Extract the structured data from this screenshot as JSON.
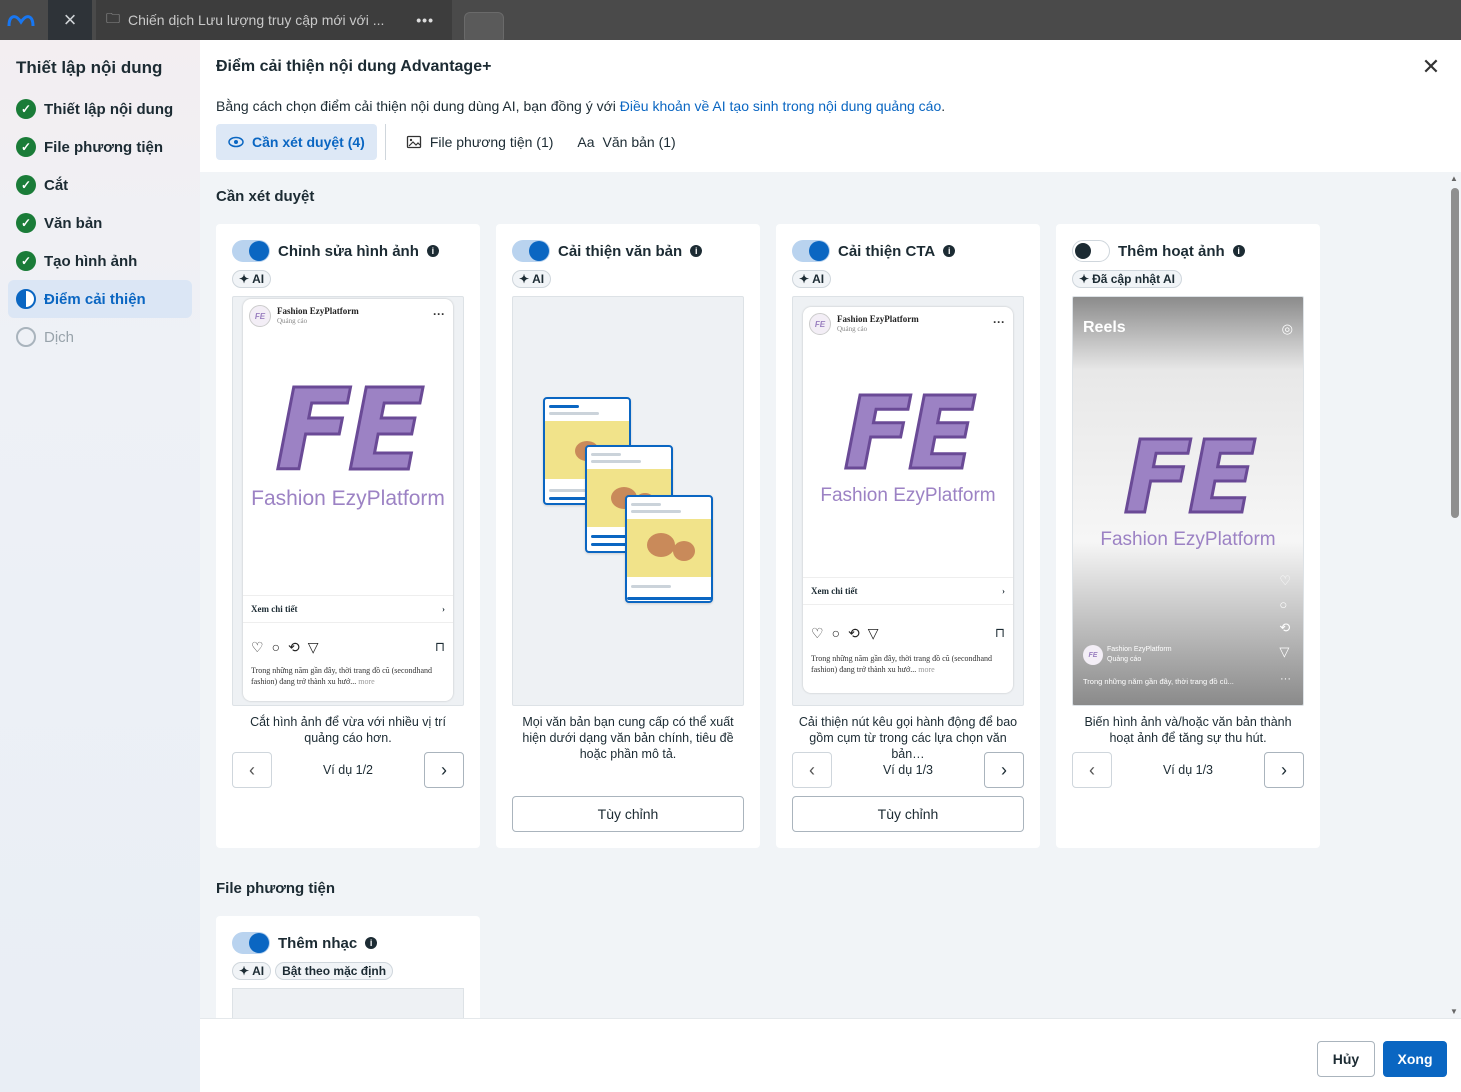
{
  "topbar": {
    "close_icon": "close-icon",
    "campaign_title": "Chiến dịch Lưu lượng truy cập mới với ...",
    "more": "•••"
  },
  "sidebar": {
    "title": "Thiết lập nội dung",
    "steps": [
      {
        "label": "Thiết lập nội dung",
        "state": "done"
      },
      {
        "label": "File phương tiện",
        "state": "done"
      },
      {
        "label": "Cắt",
        "state": "done"
      },
      {
        "label": "Văn bản",
        "state": "done"
      },
      {
        "label": "Tạo hình ảnh",
        "state": "done"
      },
      {
        "label": "Điểm cải thiện",
        "state": "active"
      },
      {
        "label": "Dịch",
        "state": "todo"
      }
    ]
  },
  "dialog": {
    "title": "Điểm cải thiện nội dung Advantage+",
    "subtitle_prefix": "Bằng cách chọn điểm cải thiện nội dung dùng AI, bạn đồng ý với ",
    "subtitle_link": "Điều khoản về AI tạo sinh trong nội dung quảng cáo",
    "subtitle_suffix": ".",
    "tabs": [
      {
        "label": "Cần xét duyệt (4)",
        "icon": "eye-icon"
      },
      {
        "label": "File phương tiện (1)",
        "icon": "image-icon"
      },
      {
        "label": "Văn bản (1)",
        "icon": "Aa"
      }
    ]
  },
  "review_section": {
    "title": "Cần xét duyệt",
    "cards": [
      {
        "title": "Chỉnh sửa hình ảnh",
        "badge": "AI",
        "desc": "Cắt hình ảnh để vừa với nhiều vị trí quảng cáo hơn.",
        "pager": "Ví dụ 1/2"
      },
      {
        "title": "Cải thiện văn bản",
        "badge": "AI",
        "desc": "Mọi văn bản bạn cung cấp có thể xuất hiện dưới dạng văn bản chính, tiêu đề hoặc phần mô tả.",
        "button": "Tùy chỉnh"
      },
      {
        "title": "Cải thiện CTA",
        "badge": "AI",
        "desc": "Cải thiện nút kêu gọi hành động để bao gồm cụm từ trong các lựa chọn văn bản…",
        "pager": "Ví dụ 1/3",
        "button": "Tùy chỉnh"
      },
      {
        "title": "Thêm hoạt ảnh",
        "badge": "Đã cập nhật AI",
        "desc": "Biến hình ảnh và/hoặc văn bản thành hoạt ảnh để tăng sự thu hút.",
        "pager": "Ví dụ 1/3"
      }
    ]
  },
  "ad_preview": {
    "page_name": "Fashion EzyPlatform",
    "sponsored": "Quảng cáo",
    "logo_big": "FE",
    "logo_small": "Fashion EzyPlatform",
    "cta": "Xem chi tiết",
    "text": "Trong những năm gần đây, thời trang đồ cũ (secondhand fashion) đang trở thành xu hướ...",
    "more": "more",
    "reels_label": "Reels",
    "reels_text": "Trong những năm gần đây, thời trang đồ cũ..."
  },
  "media_section": {
    "title": "File phương tiện",
    "card": {
      "title": "Thêm nhạc",
      "badge_ai": "AI",
      "badge_default": "Bật theo mặc định"
    }
  },
  "footer": {
    "cancel": "Hủy",
    "done": "Xong"
  },
  "colors": {
    "accent": "#0a66c2",
    "success": "#1a7c38",
    "logo_purple": "#9c82c4"
  }
}
